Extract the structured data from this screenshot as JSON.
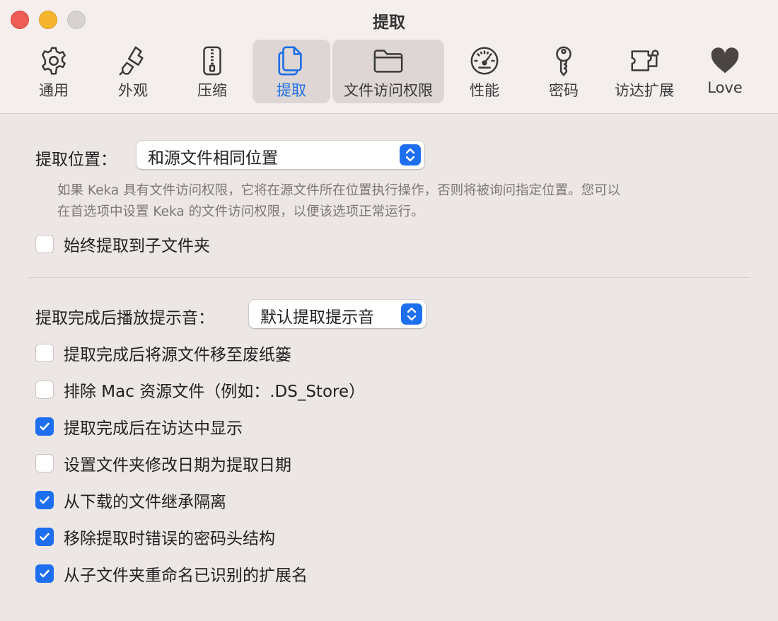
{
  "window": {
    "title": "提取"
  },
  "tabs": [
    {
      "label": "通用",
      "icon": "gear-icon"
    },
    {
      "label": "外观",
      "icon": "paintbrush-icon"
    },
    {
      "label": "压缩",
      "icon": "zipper-archive-icon"
    },
    {
      "label": "提取",
      "icon": "documents-icon",
      "active": true
    },
    {
      "label": "文件访问权限",
      "icon": "folder-icon"
    },
    {
      "label": "性能",
      "icon": "gauge-icon"
    },
    {
      "label": "密码",
      "icon": "key-icon"
    },
    {
      "label": "访达扩展",
      "icon": "puzzle-extension-icon"
    },
    {
      "label": "Love",
      "icon": "heart-icon"
    }
  ],
  "extract_location": {
    "label": "提取位置：",
    "value": "和源文件相同位置",
    "help_line1": "如果 Keka 具有文件访问权限，它将在源文件所在位置执行操作，否则将被询问指定位置。您可以",
    "help_line2": "在首选项中设置 Keka 的文件访问权限，以便该选项正常运行。"
  },
  "always_subfolder": {
    "label": "始终提取到子文件夹",
    "checked": false
  },
  "sound": {
    "label": "提取完成后播放提示音：",
    "value": "默认提取提示音"
  },
  "options": [
    {
      "label": "提取完成后将源文件移至废纸篓",
      "checked": false
    },
    {
      "label": "排除 Mac 资源文件（例如：.DS_Store）",
      "checked": false
    },
    {
      "label": "提取完成后在访达中显示",
      "checked": true
    },
    {
      "label": "设置文件夹修改日期为提取日期",
      "checked": false
    },
    {
      "label": "从下载的文件继承隔离",
      "checked": true
    },
    {
      "label": "移除提取时错误的密码头结构",
      "checked": true
    },
    {
      "label": "从子文件夹重命名已识别的扩展名",
      "checked": true
    }
  ],
  "colors": {
    "accent": "#1d6ff0",
    "close": "#ee5d55",
    "minimize": "#f5b52e",
    "zoom": "#d7d2d0",
    "background": "#ece6e4"
  }
}
